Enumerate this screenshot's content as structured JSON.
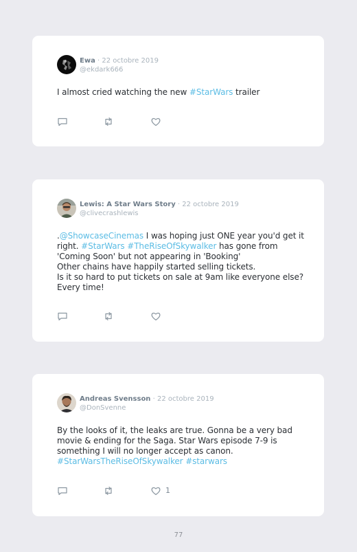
{
  "tweets": [
    {
      "name": "Ewa",
      "date": "· 22 octobre 2019",
      "handle": "@ekdark666",
      "text": {
        "l1a": "I almost cried watching the new ",
        "tag1": "#StarWars",
        "l1b": " trailer"
      }
    },
    {
      "name": "Lewis: A Star Wars Story",
      "date": "· 22 octobre 2019",
      "handle": "@clivecrashlewis",
      "text": {
        "dot": ".",
        "mention": "@ShowcaseCinemas",
        "l1": " I was hoping just ONE year you'd get it right. ",
        "tag1": "#StarWars",
        "space": " ",
        "tag2": "#TheRiseOfSkywalker",
        "l2": " has gone from 'Coming Soon' but not appearing in 'Booking'",
        "l3": "Other chains have happily started selling tickets.",
        "l4": "Is it so hard to put tickets on sale at 9am like everyone else? Every time!"
      }
    },
    {
      "name": "Andreas Svensson",
      "date": "· 22 octobre 2019",
      "handle": "@DonSvenne",
      "text": {
        "l1": "By the looks of it, the leaks are true. Gonna be a very bad movie & ending for the Saga. Star Wars episode 7-9 is something I will no longer accept as canon.",
        "tag1": "#StarWarsTheRiseOfSkywalker",
        "space": " ",
        "tag2": "#starwars"
      },
      "like_count": "1"
    }
  ],
  "page_number": "77"
}
